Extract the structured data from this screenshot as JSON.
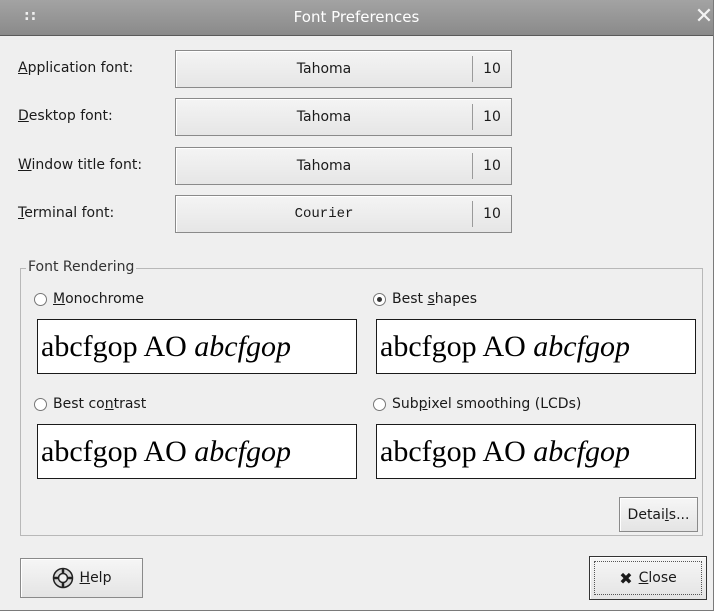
{
  "window": {
    "title": "Font Preferences",
    "grip": "::",
    "close_glyph": "✕"
  },
  "fonts": [
    {
      "label_mnemonic": "A",
      "label_rest": "pplication font:",
      "family": "Tahoma",
      "size": "10"
    },
    {
      "label_mnemonic": "D",
      "label_rest": "esktop font:",
      "family": "Tahoma",
      "size": "10"
    },
    {
      "label_mnemonic": "W",
      "label_rest": "indow title font:",
      "family": "Tahoma",
      "size": "10"
    },
    {
      "label_mnemonic": "T",
      "label_rest": "erminal font:",
      "family": "Courier",
      "size": "10"
    }
  ],
  "rendering": {
    "group_title": "Font Rendering",
    "sample_text": "abcfgop AO ",
    "sample_italic": "abcfgop",
    "options": [
      {
        "pre": "",
        "mnemonic": "M",
        "post": "onochrome",
        "selected": false
      },
      {
        "pre": "Best ",
        "mnemonic": "s",
        "post": "hapes",
        "selected": true
      },
      {
        "pre": "Best co",
        "mnemonic": "n",
        "post": "trast",
        "selected": false
      },
      {
        "pre": "Sub",
        "mnemonic": "p",
        "post": "ixel smoothing (LCDs)",
        "selected": false
      }
    ],
    "details": {
      "pre": "Detai",
      "mnemonic": "l",
      "post": "s..."
    }
  },
  "buttons": {
    "help": {
      "mnemonic": "H",
      "post": "elp"
    },
    "close": {
      "glyph": "✖",
      "mnemonic": "C",
      "post": "lose"
    }
  }
}
